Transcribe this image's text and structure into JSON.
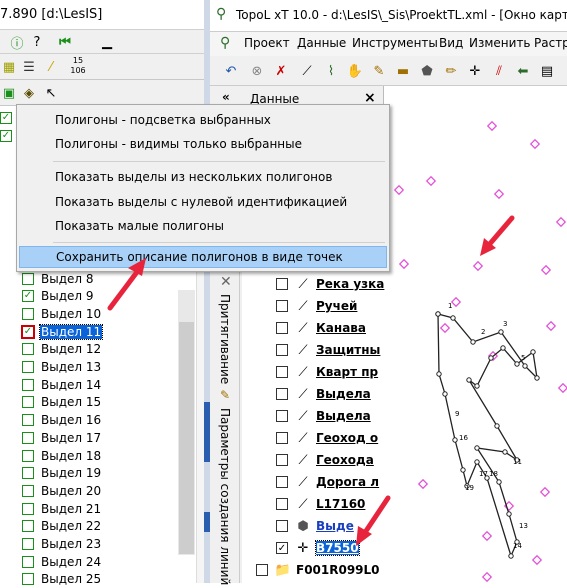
{
  "left_window": {
    "title": "7.890  [d:\\LesIS]",
    "toolbar1": {
      "help_label": "?",
      "counter": "15\n106"
    },
    "tree_items": [
      {
        "label": "Выдел 8",
        "checked": false
      },
      {
        "label": "Выдел 9",
        "checked": true
      },
      {
        "label": "Выдел 10",
        "checked": false
      },
      {
        "label": "Выдел 11",
        "checked": true,
        "selected": true
      },
      {
        "label": "Выдел 12",
        "checked": false
      },
      {
        "label": "Выдел 13",
        "checked": false
      },
      {
        "label": "Выдел 14",
        "checked": false
      },
      {
        "label": "Выдел 15",
        "checked": false
      },
      {
        "label": "Выдел 16",
        "checked": false
      },
      {
        "label": "Выдел 17",
        "checked": false
      },
      {
        "label": "Выдел 18",
        "checked": false
      },
      {
        "label": "Выдел 19",
        "checked": false
      },
      {
        "label": "Выдел 20",
        "checked": false
      },
      {
        "label": "Выдел 21",
        "checked": false
      },
      {
        "label": "Выдел 22",
        "checked": false
      },
      {
        "label": "Выдел 23",
        "checked": false
      },
      {
        "label": "Выдел 24",
        "checked": false
      },
      {
        "label": "Выдел 25",
        "checked": false
      }
    ]
  },
  "right_window": {
    "title": "TopoL xT 10.0 - d:\\LesIS\\_Sis\\ProektTL.xml - [Окно карт",
    "menu": [
      "Проект",
      "Данные",
      "Инструменты",
      "Вид",
      "Изменить",
      "Растр"
    ],
    "panel_title": "Данные",
    "panel_close": "×",
    "panel_collapse": "«",
    "vertical_tabs": [
      "Притягивание",
      "Параметры создания линий"
    ],
    "layers": [
      {
        "label": "Река узка",
        "symbol": "line",
        "checked": false
      },
      {
        "label": "Ручей",
        "symbol": "line",
        "checked": false
      },
      {
        "label": "Канава",
        "symbol": "line",
        "checked": false
      },
      {
        "label": "Защитны",
        "symbol": "line",
        "checked": false
      },
      {
        "label": "Кварт пр",
        "symbol": "line",
        "checked": false
      },
      {
        "label": "Выдела",
        "symbol": "line",
        "checked": false
      },
      {
        "label": "Выдела",
        "symbol": "line",
        "checked": false
      },
      {
        "label": "Геоход о",
        "symbol": "line",
        "checked": false
      },
      {
        "label": "Геохода",
        "symbol": "line",
        "checked": false
      },
      {
        "label": "Дорога л",
        "symbol": "line",
        "checked": false
      },
      {
        "label": "L17160",
        "symbol": "line",
        "checked": false
      },
      {
        "label": "Выде",
        "symbol": "polygon",
        "checked": false
      },
      {
        "label": "B7550",
        "symbol": "point",
        "checked": true,
        "selected": true
      },
      {
        "label": "F001R099L0",
        "symbol": "folder",
        "checked": false
      }
    ],
    "map_labels": [
      "1",
      "2",
      "3",
      "5",
      "9",
      "13",
      "14",
      "11",
      "16",
      "17",
      "18",
      "19"
    ]
  },
  "context_menu": {
    "items": [
      {
        "label": "Полигоны  - подсветка выбранных",
        "highlighted": false
      },
      {
        "label": "Полигоны - видимы только выбранные",
        "highlighted": false
      },
      {
        "label": "Показать выделы из нескольких полигонов",
        "highlighted": false
      },
      {
        "label": "Показать выделы с нулевой идентификацией",
        "highlighted": false
      },
      {
        "label": "Показать малые полигоны",
        "highlighted": false
      },
      {
        "label": "Сохранить описание полигонов в виде точек",
        "highlighted": true
      }
    ]
  },
  "colors": {
    "accent": "#1a8f1a",
    "highlight": "#a9d1f7",
    "arrow": "#e8243c",
    "selection": "#0a64d8",
    "map_points": "#e64bd8"
  }
}
